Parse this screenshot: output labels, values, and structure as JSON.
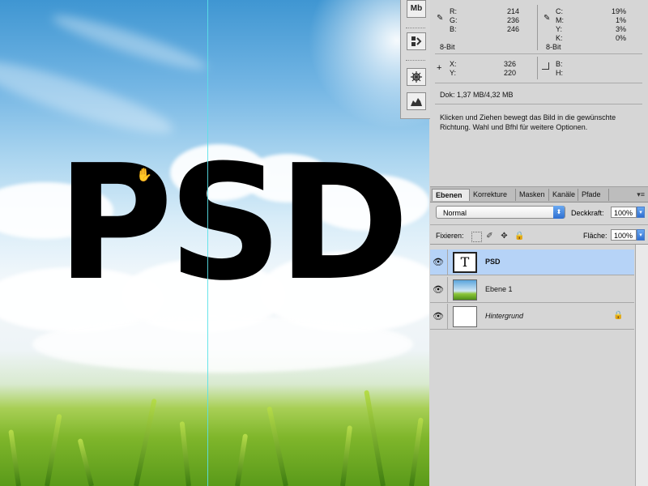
{
  "canvas": {
    "text": "PSD"
  },
  "strip": {
    "mb_label": "Mb"
  },
  "info": {
    "rgb": [
      {
        "label": "R:",
        "value": "214"
      },
      {
        "label": "G:",
        "value": "236"
      },
      {
        "label": "B:",
        "value": "246"
      }
    ],
    "rgb_bits": "8-Bit",
    "cmyk": [
      {
        "label": "C:",
        "value": "19%"
      },
      {
        "label": "M:",
        "value": "1%"
      },
      {
        "label": "Y:",
        "value": "3%"
      },
      {
        "label": "K:",
        "value": "0%"
      }
    ],
    "cmyk_bits": "8-Bit",
    "xy": [
      {
        "label": "X:",
        "value": "326"
      },
      {
        "label": "Y:",
        "value": "220"
      }
    ],
    "bh": [
      {
        "label": "B:",
        "value": ""
      },
      {
        "label": "H:",
        "value": ""
      }
    ],
    "doc": "Dok: 1,37 MB/4,32 MB",
    "hint_line1": "Klicken und Ziehen bewegt das Bild in die gewünschte",
    "hint_line2": "Richtung. Wahl und Bfhl für weitere Optionen."
  },
  "layers": {
    "tabs": [
      "Ebenen",
      "Korrekture",
      "Masken",
      "Kanäle",
      "Pfade"
    ],
    "blend_mode": "Normal",
    "opacity_label": "Deckkraft:",
    "opacity_value": "100%",
    "lock_label": "Fixieren:",
    "fill_label": "Fläche:",
    "fill_value": "100%",
    "items": [
      {
        "name": "PSD",
        "thumb": "T"
      },
      {
        "name": "Ebene 1"
      },
      {
        "name": "Hintergrund"
      }
    ]
  }
}
